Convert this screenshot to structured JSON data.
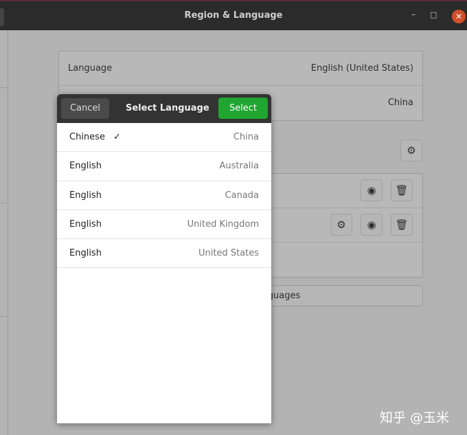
{
  "window": {
    "title": "Region & Language",
    "minimize": "–",
    "maximize": "□",
    "close": "✕"
  },
  "settings": {
    "rows": [
      {
        "label": "Language",
        "value": "English (United States)"
      },
      {
        "label": "",
        "value": "China"
      }
    ],
    "manage_button": "Manage Installed Languages"
  },
  "dialog": {
    "cancel": "Cancel",
    "title": "Select Language",
    "select": "Select",
    "items": [
      {
        "language": "Chinese",
        "region": "China",
        "selected": true,
        "check": "✓"
      },
      {
        "language": "English",
        "region": "Australia"
      },
      {
        "language": "English",
        "region": "Canada"
      },
      {
        "language": "English",
        "region": "United Kingdom"
      },
      {
        "language": "English",
        "region": "United States"
      }
    ]
  },
  "watermark": "知乎 @玉米"
}
